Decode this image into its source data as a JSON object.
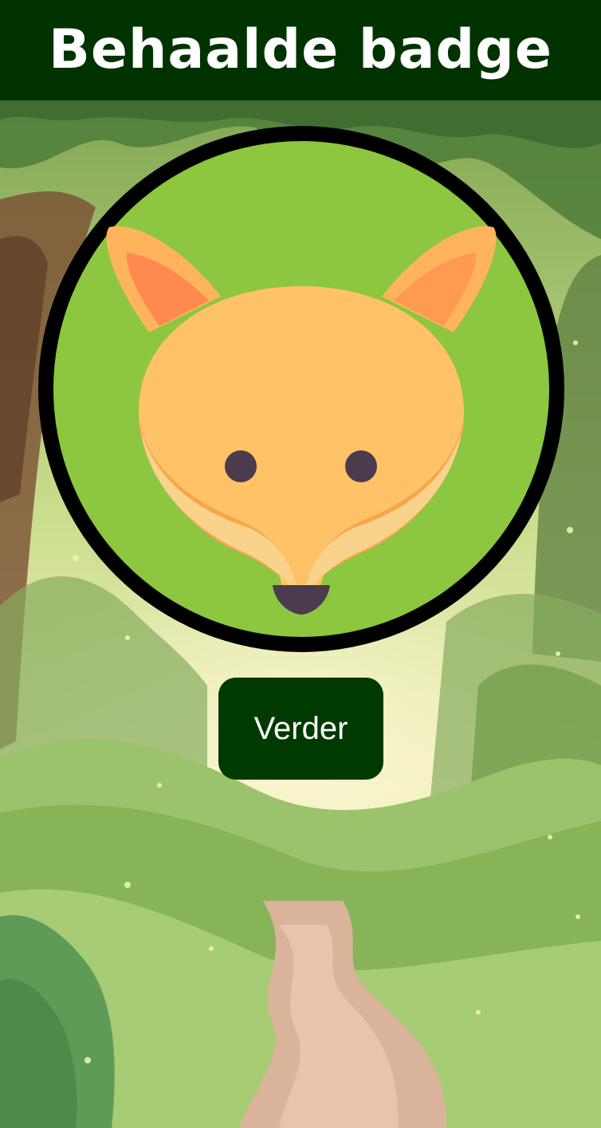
{
  "header": {
    "title": "Behaalde badge"
  },
  "badge": {
    "icon": "fox-icon",
    "background_color": "#8dc63f",
    "ring_color": "#000000"
  },
  "actions": {
    "continue_label": "Verder"
  },
  "colors": {
    "header_bg": "#003300",
    "button_bg": "#003a00",
    "text": "#ffffff"
  }
}
